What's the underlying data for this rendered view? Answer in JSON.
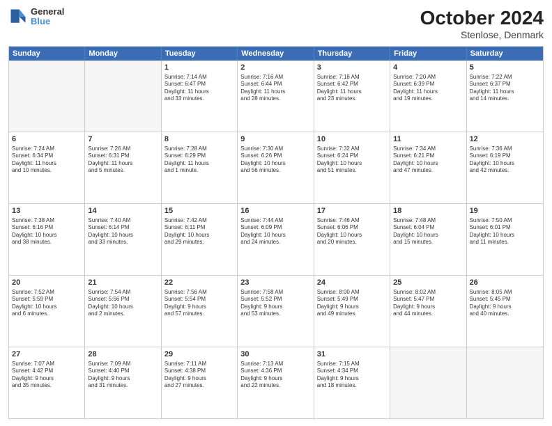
{
  "header": {
    "logo_line1": "General",
    "logo_line2": "Blue",
    "title": "October 2024",
    "subtitle": "Stenlose, Denmark"
  },
  "days": [
    "Sunday",
    "Monday",
    "Tuesday",
    "Wednesday",
    "Thursday",
    "Friday",
    "Saturday"
  ],
  "rows": [
    [
      {
        "num": "",
        "text": "",
        "empty": true
      },
      {
        "num": "",
        "text": "",
        "empty": true
      },
      {
        "num": "1",
        "text": "Sunrise: 7:14 AM\nSunset: 6:47 PM\nDaylight: 11 hours\nand 33 minutes."
      },
      {
        "num": "2",
        "text": "Sunrise: 7:16 AM\nSunset: 6:44 PM\nDaylight: 11 hours\nand 28 minutes."
      },
      {
        "num": "3",
        "text": "Sunrise: 7:18 AM\nSunset: 6:42 PM\nDaylight: 11 hours\nand 23 minutes."
      },
      {
        "num": "4",
        "text": "Sunrise: 7:20 AM\nSunset: 6:39 PM\nDaylight: 11 hours\nand 19 minutes."
      },
      {
        "num": "5",
        "text": "Sunrise: 7:22 AM\nSunset: 6:37 PM\nDaylight: 11 hours\nand 14 minutes."
      }
    ],
    [
      {
        "num": "6",
        "text": "Sunrise: 7:24 AM\nSunset: 6:34 PM\nDaylight: 11 hours\nand 10 minutes."
      },
      {
        "num": "7",
        "text": "Sunrise: 7:26 AM\nSunset: 6:31 PM\nDaylight: 11 hours\nand 5 minutes."
      },
      {
        "num": "8",
        "text": "Sunrise: 7:28 AM\nSunset: 6:29 PM\nDaylight: 11 hours\nand 1 minute."
      },
      {
        "num": "9",
        "text": "Sunrise: 7:30 AM\nSunset: 6:26 PM\nDaylight: 10 hours\nand 56 minutes."
      },
      {
        "num": "10",
        "text": "Sunrise: 7:32 AM\nSunset: 6:24 PM\nDaylight: 10 hours\nand 51 minutes."
      },
      {
        "num": "11",
        "text": "Sunrise: 7:34 AM\nSunset: 6:21 PM\nDaylight: 10 hours\nand 47 minutes."
      },
      {
        "num": "12",
        "text": "Sunrise: 7:36 AM\nSunset: 6:19 PM\nDaylight: 10 hours\nand 42 minutes."
      }
    ],
    [
      {
        "num": "13",
        "text": "Sunrise: 7:38 AM\nSunset: 6:16 PM\nDaylight: 10 hours\nand 38 minutes."
      },
      {
        "num": "14",
        "text": "Sunrise: 7:40 AM\nSunset: 6:14 PM\nDaylight: 10 hours\nand 33 minutes."
      },
      {
        "num": "15",
        "text": "Sunrise: 7:42 AM\nSunset: 6:11 PM\nDaylight: 10 hours\nand 29 minutes."
      },
      {
        "num": "16",
        "text": "Sunrise: 7:44 AM\nSunset: 6:09 PM\nDaylight: 10 hours\nand 24 minutes."
      },
      {
        "num": "17",
        "text": "Sunrise: 7:46 AM\nSunset: 6:06 PM\nDaylight: 10 hours\nand 20 minutes."
      },
      {
        "num": "18",
        "text": "Sunrise: 7:48 AM\nSunset: 6:04 PM\nDaylight: 10 hours\nand 15 minutes."
      },
      {
        "num": "19",
        "text": "Sunrise: 7:50 AM\nSunset: 6:01 PM\nDaylight: 10 hours\nand 11 minutes."
      }
    ],
    [
      {
        "num": "20",
        "text": "Sunrise: 7:52 AM\nSunset: 5:59 PM\nDaylight: 10 hours\nand 6 minutes."
      },
      {
        "num": "21",
        "text": "Sunrise: 7:54 AM\nSunset: 5:56 PM\nDaylight: 10 hours\nand 2 minutes."
      },
      {
        "num": "22",
        "text": "Sunrise: 7:56 AM\nSunset: 5:54 PM\nDaylight: 9 hours\nand 57 minutes."
      },
      {
        "num": "23",
        "text": "Sunrise: 7:58 AM\nSunset: 5:52 PM\nDaylight: 9 hours\nand 53 minutes."
      },
      {
        "num": "24",
        "text": "Sunrise: 8:00 AM\nSunset: 5:49 PM\nDaylight: 9 hours\nand 49 minutes."
      },
      {
        "num": "25",
        "text": "Sunrise: 8:02 AM\nSunset: 5:47 PM\nDaylight: 9 hours\nand 44 minutes."
      },
      {
        "num": "26",
        "text": "Sunrise: 8:05 AM\nSunset: 5:45 PM\nDaylight: 9 hours\nand 40 minutes."
      }
    ],
    [
      {
        "num": "27",
        "text": "Sunrise: 7:07 AM\nSunset: 4:42 PM\nDaylight: 9 hours\nand 35 minutes."
      },
      {
        "num": "28",
        "text": "Sunrise: 7:09 AM\nSunset: 4:40 PM\nDaylight: 9 hours\nand 31 minutes."
      },
      {
        "num": "29",
        "text": "Sunrise: 7:11 AM\nSunset: 4:38 PM\nDaylight: 9 hours\nand 27 minutes."
      },
      {
        "num": "30",
        "text": "Sunrise: 7:13 AM\nSunset: 4:36 PM\nDaylight: 9 hours\nand 22 minutes."
      },
      {
        "num": "31",
        "text": "Sunrise: 7:15 AM\nSunset: 4:34 PM\nDaylight: 9 hours\nand 18 minutes."
      },
      {
        "num": "",
        "text": "",
        "empty": true
      },
      {
        "num": "",
        "text": "",
        "empty": true
      }
    ]
  ]
}
